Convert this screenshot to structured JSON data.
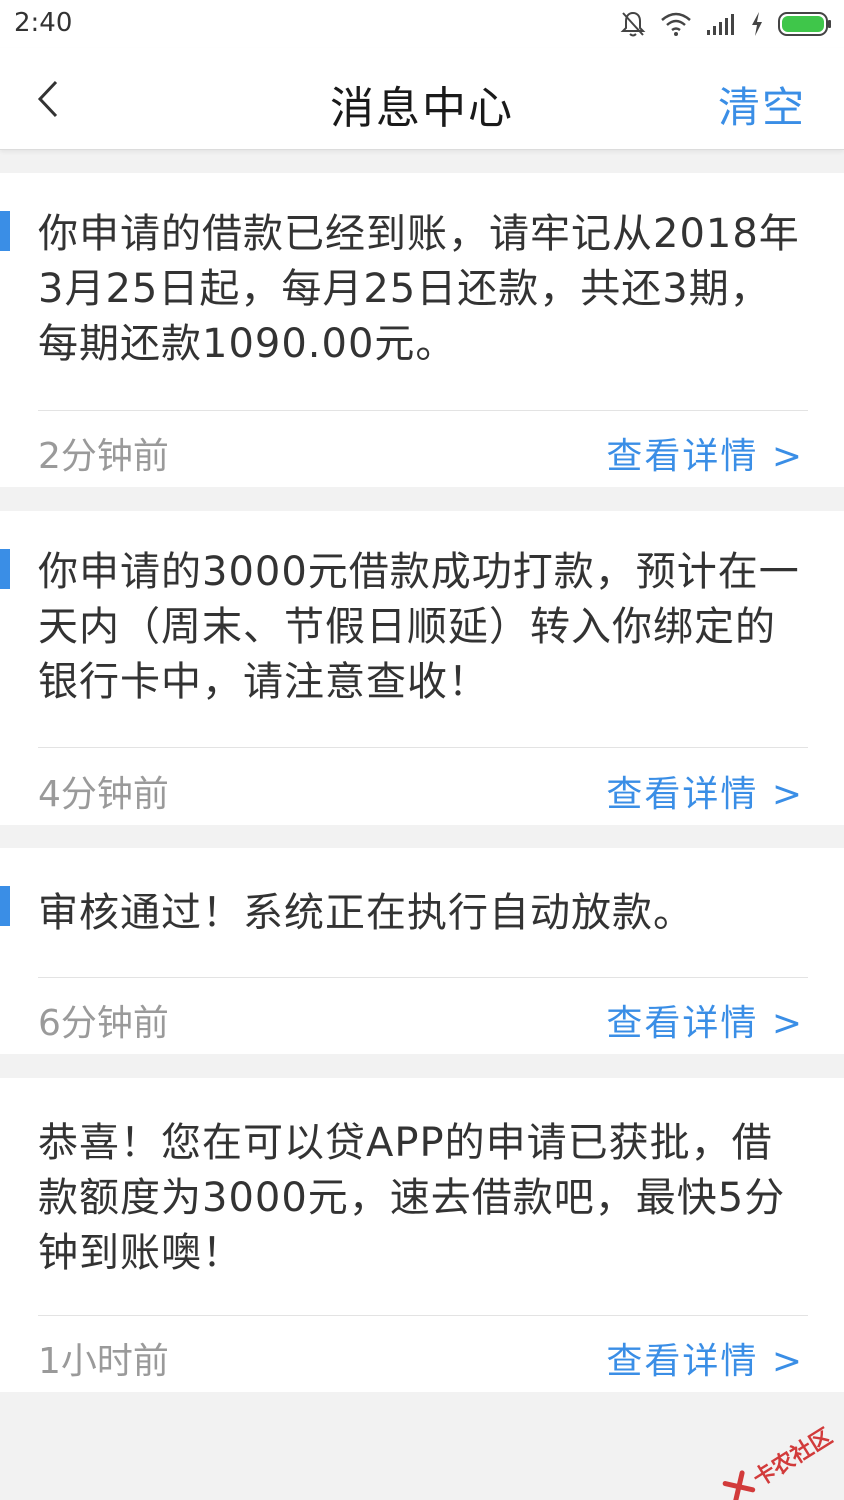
{
  "status_bar": {
    "time": "2:40",
    "icons": [
      "bell-muted-icon",
      "wifi-icon",
      "signal-icon",
      "charging-icon",
      "battery-icon"
    ]
  },
  "header": {
    "title": "消息中心",
    "back_icon": "chevron-left-icon",
    "clear_label": "清空"
  },
  "messages": [
    {
      "text": "你申请的借款已经到账，请牢记从2018年3月25日起，每月25日还款，共还3期，每期还款1090.00元。",
      "time": "2分钟前",
      "detail_label": "查看详情 >",
      "unread": true
    },
    {
      "text": "你申请的3000元借款成功打款，预计在一天内（周末、节假日顺延）转入你绑定的银行卡中，请注意查收！",
      "time": "4分钟前",
      "detail_label": "查看详情 >",
      "unread": true
    },
    {
      "text": "审核通过！系统正在执行自动放款。",
      "time": "6分钟前",
      "detail_label": "查看详情 >",
      "unread": true
    },
    {
      "text": "恭喜！您在可以贷APP的申请已获批，借款额度为3000元，速去借款吧，最快5分钟到账噢！",
      "time": "1小时前",
      "detail_label": "查看详情 >",
      "unread": false
    }
  ],
  "watermark": {
    "text": "卡农社区"
  },
  "colors": {
    "accent": "#3a8ee6",
    "background": "#f2f2f2",
    "card": "#ffffff",
    "time_text": "#9a9a9a",
    "body_text": "#333333"
  }
}
